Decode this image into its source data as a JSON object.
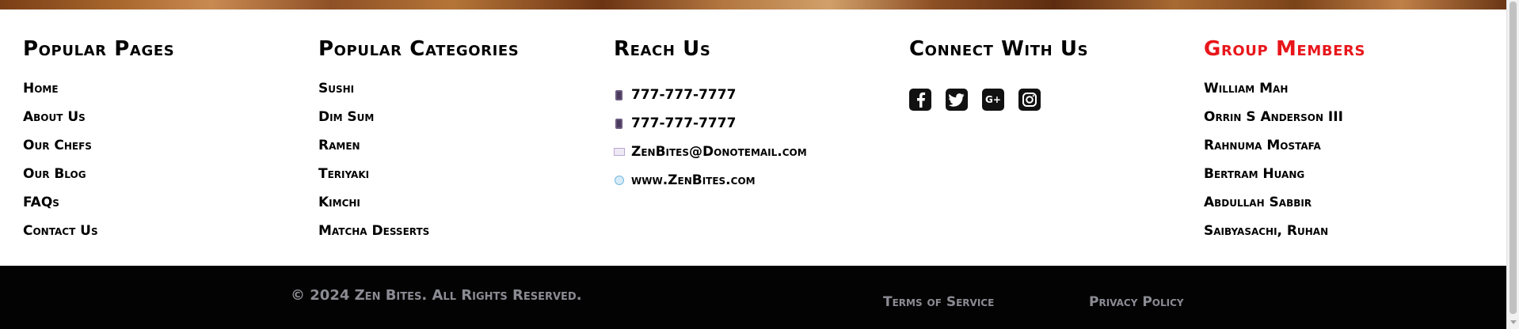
{
  "popular_pages": {
    "title": "Popular Pages",
    "links": [
      "Home",
      "About Us",
      "Our Chefs",
      "Our Blog",
      "FAQs",
      "Contact Us"
    ]
  },
  "popular_categories": {
    "title": "Popular Categories",
    "links": [
      "Sushi",
      "Dim Sum",
      "Ramen",
      "Teriyaki",
      "Kimchi",
      "Matcha Desserts"
    ]
  },
  "reach_us": {
    "title": "Reach Us",
    "phone_1": "777-777-7777",
    "phone_2": "777-777-7777",
    "email": "ZenBites@Donotemail.com",
    "website": "www.ZenBites.com"
  },
  "connect": {
    "title": "Connect With Us",
    "icons": [
      "facebook-icon",
      "twitter-icon",
      "google-plus-icon",
      "instagram-icon"
    ],
    "google_plus_glyph": "G+"
  },
  "group_members": {
    "title": "Group Members",
    "title_color": "#e8161b",
    "members": [
      "William Mah",
      "Orrin S Anderson III",
      "Rahnuma Mostafa",
      "Bertram Huang",
      "Abdullah Sabbir",
      "Saibyasachi, Ruhan"
    ]
  },
  "bottom_bar": {
    "copyright": "© 2024 Zen Bites. All Rights Reserved.",
    "terms": "Terms of Service",
    "privacy": "Privacy Policy",
    "text_color": "#8b8b93"
  }
}
